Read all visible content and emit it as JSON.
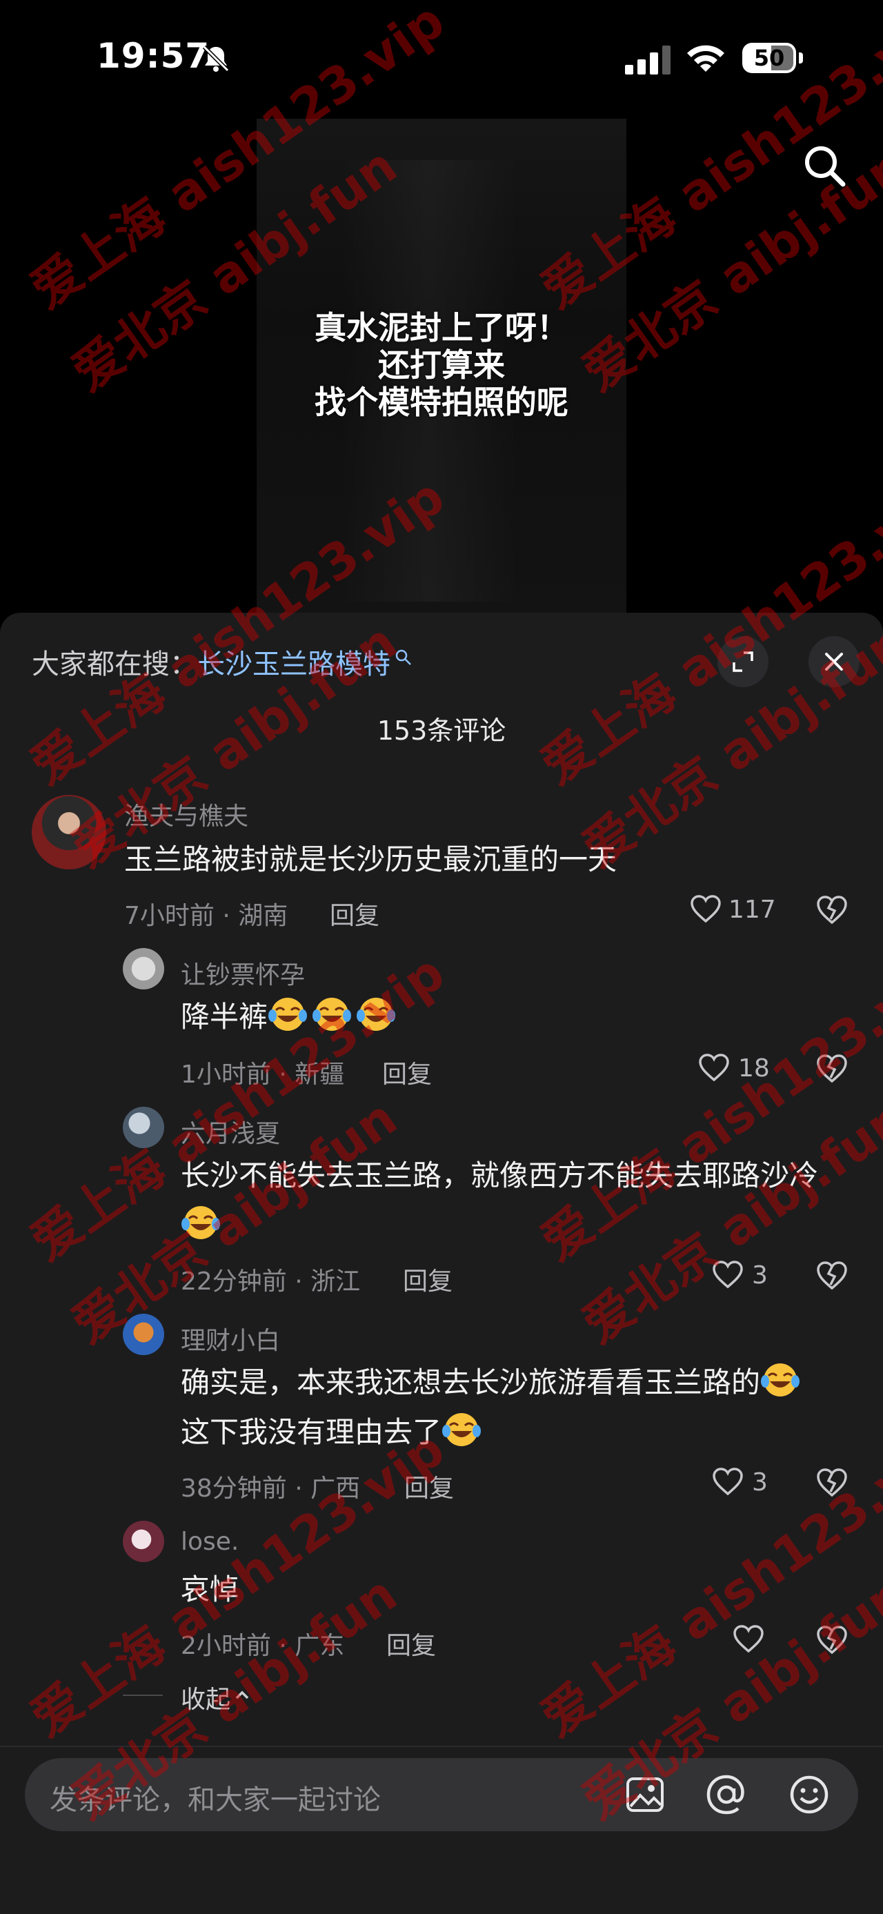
{
  "status_bar": {
    "time": "19:57",
    "battery": "50"
  },
  "video": {
    "caption_lines": [
      "真水泥封上了呀！",
      "还打算来",
      "找个模特拍照的呢"
    ]
  },
  "trending": {
    "label": "大家都在搜：",
    "keyword": "长沙玉兰路模特"
  },
  "comment_count_label": "153条评论",
  "comments": [
    {
      "name": "渔夫与樵夫",
      "text": "玉兰路被封就是长沙历史最沉重的一天",
      "meta": "7小时前 · 湖南",
      "reply": "回复",
      "likes": "117"
    },
    {
      "name": "让钞票怀孕",
      "text": "降半裤",
      "meta": "1小时前 · 新疆",
      "reply": "回复",
      "likes": "18"
    },
    {
      "name": "六月浅夏",
      "text": "长沙不能失去玉兰路，就像西方不能失去耶路沙冷",
      "meta": "22分钟前 · 浙江",
      "reply": "回复",
      "likes": "3"
    },
    {
      "name": "理财小白",
      "text_line1": "确实是，本来我还想去长沙旅游看看玉兰路的",
      "text_line2": "这下我没有理由去了",
      "meta": "38分钟前 · 广西",
      "reply": "回复",
      "likes": "3"
    },
    {
      "name": "lose.",
      "text": "哀悼",
      "meta": "2小时前 · 广东",
      "reply": "回复",
      "likes": ""
    }
  ],
  "collapse_label": "收起",
  "input": {
    "placeholder": "发条评论，和大家一起讨论"
  },
  "watermark": {
    "line1": "爱上海 aish123.vip",
    "line2": "爱北京 aibj.fun"
  },
  "colors": {
    "sheet_bg": "#1c1c1d",
    "keyword": "#8fc3ff",
    "watermark": "#d20000"
  },
  "icons": [
    "bell-slash-icon",
    "signal-icon",
    "wifi-icon",
    "battery-icon",
    "search-icon",
    "expand-icon",
    "close-icon",
    "heart-icon",
    "dislike-heart-icon",
    "image-icon",
    "at-icon",
    "emoji-icon",
    "laugh-cry-emoji"
  ]
}
